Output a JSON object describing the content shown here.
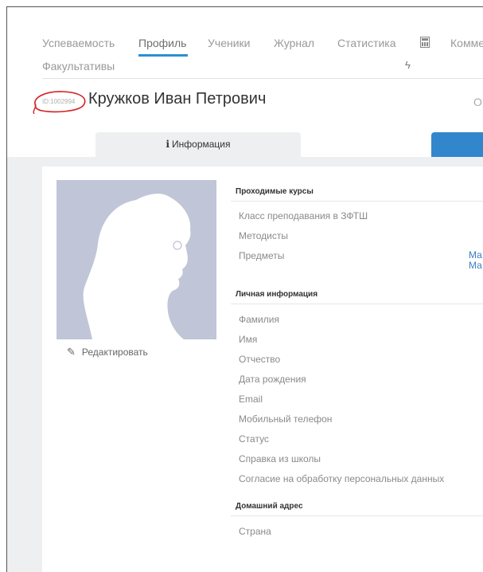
{
  "nav": {
    "items": [
      {
        "label": "Успеваемость",
        "active": false
      },
      {
        "label": "Профиль",
        "active": true
      },
      {
        "label": "Ученики",
        "active": false
      },
      {
        "label": "Журнал",
        "active": false
      },
      {
        "label": "Статистика",
        "active": false
      },
      {
        "label": "Комме",
        "active": false
      }
    ],
    "row2_label": "Факультативы",
    "bolt_icon": "bolt-icon",
    "calc_icon": "calculator-icon"
  },
  "user": {
    "id_text": "ID:1002994",
    "name": "Кружков Иван Петрович",
    "status_cut": "O"
  },
  "tabs": {
    "info_label": "Информация",
    "info_icon": "info-icon"
  },
  "profile": {
    "edit_label": "Редактировать",
    "edit_icon": "pencil-icon"
  },
  "sections": {
    "courses": {
      "title": "Проходимые курсы",
      "fields": [
        "Класс преподавания в ЗФТШ",
        "Методисты",
        "Предметы"
      ],
      "subjects_cut": [
        "Ма",
        "Ма"
      ]
    },
    "personal": {
      "title": "Личная информация",
      "fields": [
        "Фамилия",
        "Имя",
        "Отчество",
        "Дата рождения",
        "Email",
        "Мобильный телефон",
        "Статус",
        "Справка из школы",
        "Согласие на обработку персональных данных"
      ]
    },
    "address": {
      "title": "Домашний адрес",
      "fields": [
        "Страна"
      ]
    }
  },
  "colors": {
    "accent": "#2c8fd3",
    "tab_blue": "#3287cc",
    "avatar_bg": "#c0c5d7",
    "link": "#3a7fc0",
    "annotation": "#d42020"
  }
}
